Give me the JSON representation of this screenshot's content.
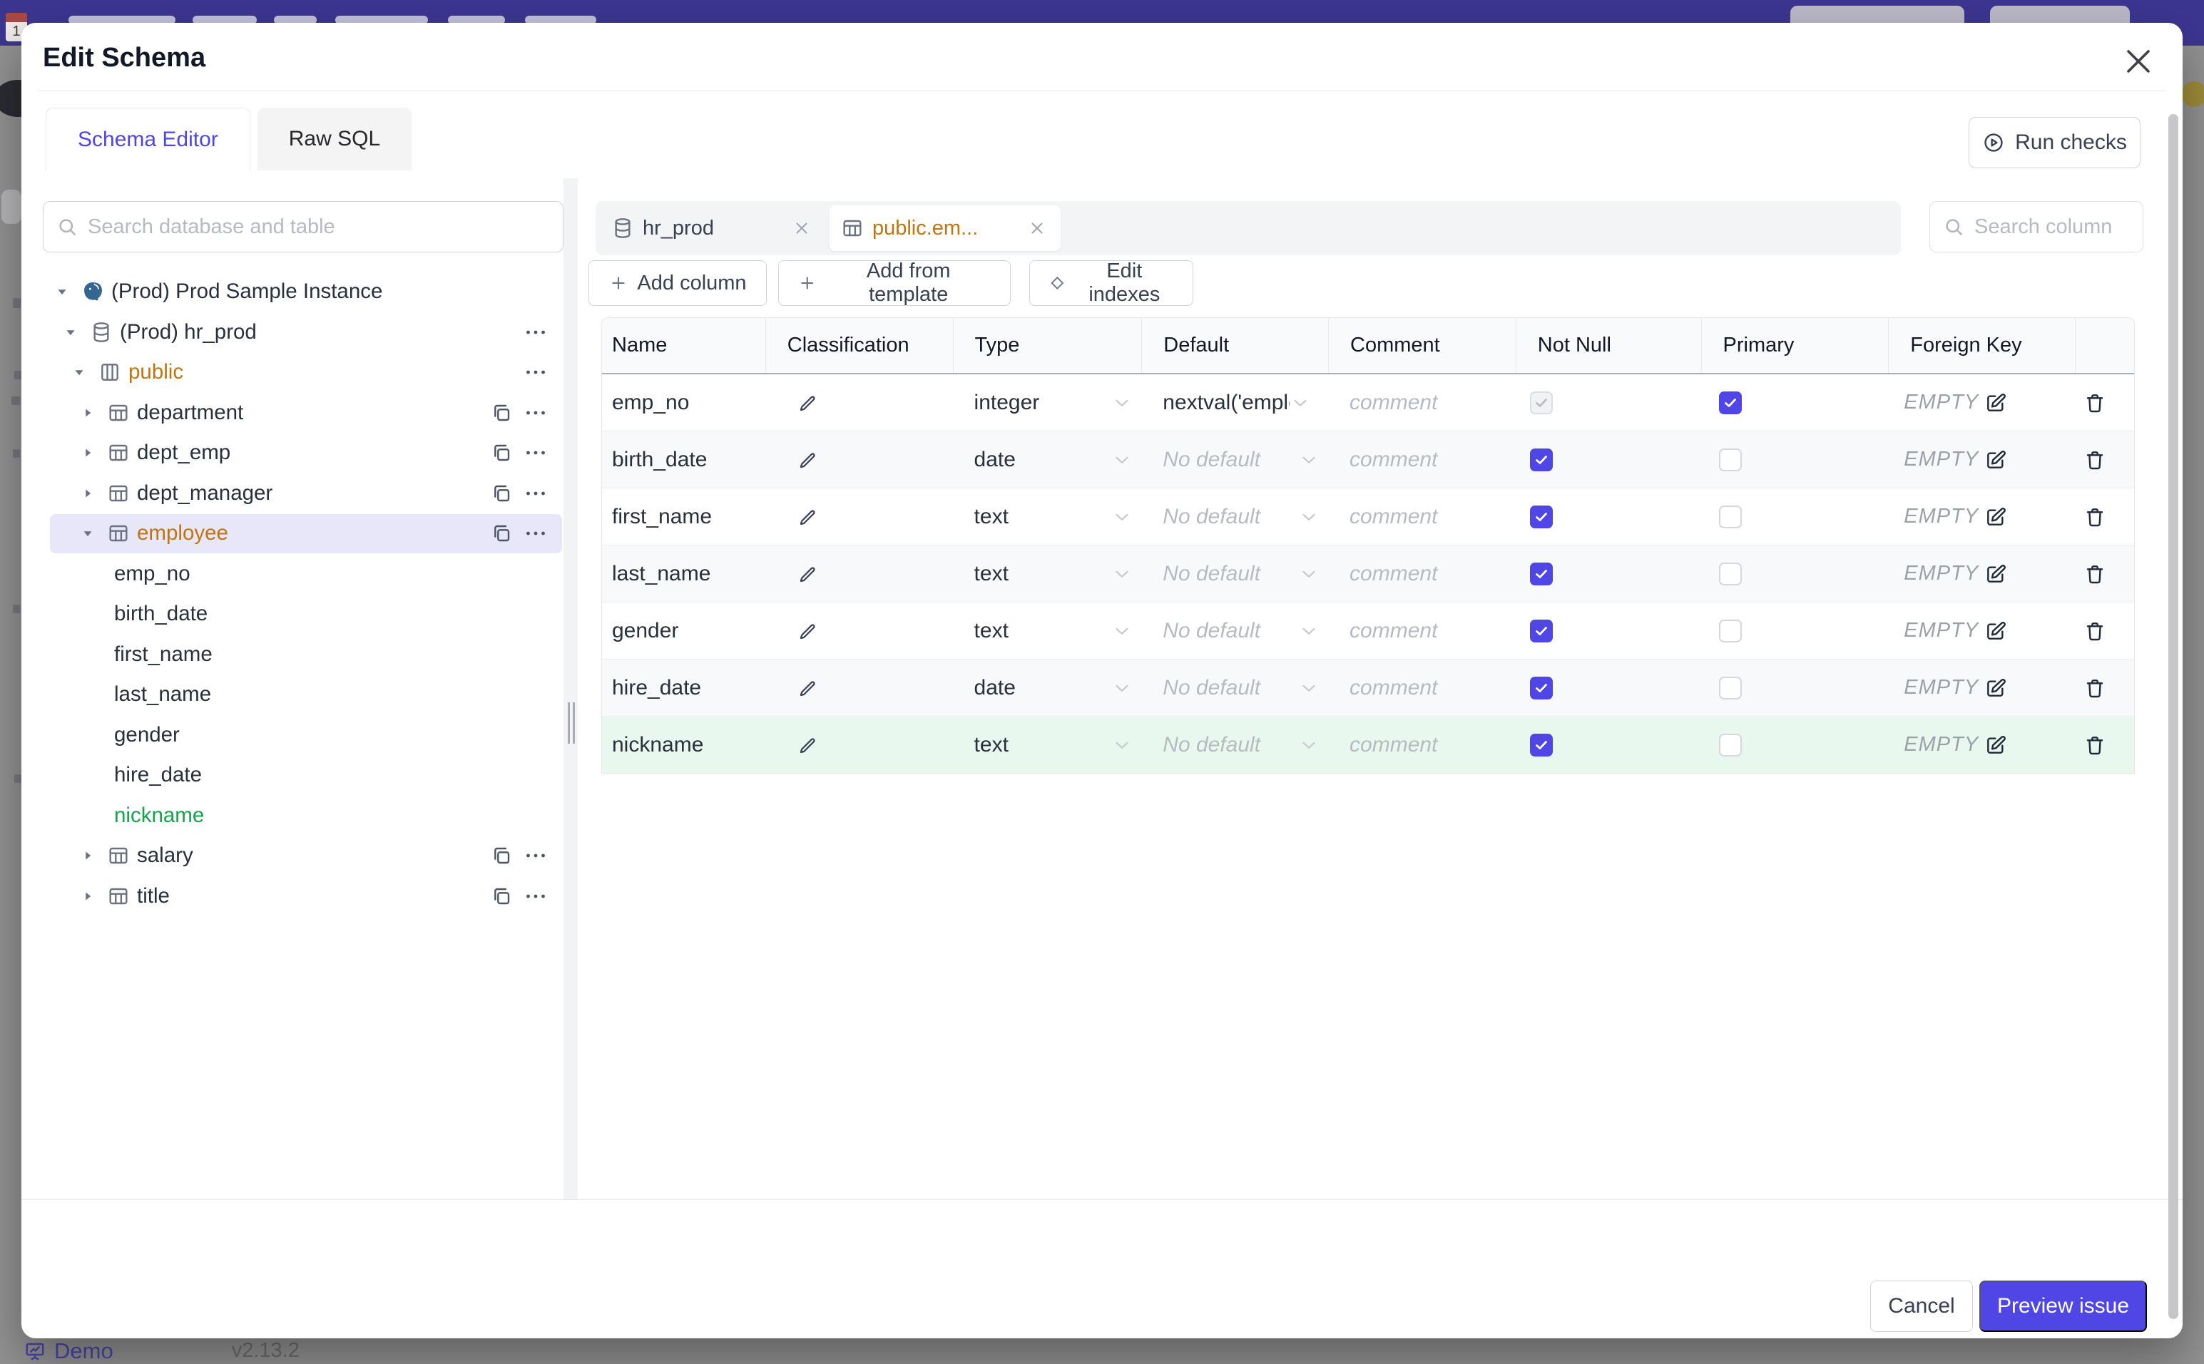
{
  "modal": {
    "title": "Edit Schema",
    "close_label": "✕",
    "tabs": [
      {
        "label": "Schema Editor",
        "active": true
      },
      {
        "label": "Raw SQL",
        "active": false
      }
    ],
    "run_checks_label": "Run checks",
    "footer": {
      "cancel_label": "Cancel",
      "primary_label": "Preview issue"
    }
  },
  "sidebar": {
    "search_placeholder": "Search database and table",
    "tree": [
      {
        "label": "(Prod) Prod Sample Instance",
        "level": 0,
        "icon": "postgres",
        "caret": "down",
        "color": null,
        "selected": false,
        "copy": false,
        "more": false
      },
      {
        "label": "(Prod) hr_prod",
        "level": 1,
        "icon": "database",
        "caret": "down",
        "color": null,
        "selected": false,
        "copy": false,
        "more": true
      },
      {
        "label": "public",
        "level": 2,
        "icon": "schema",
        "caret": "down",
        "color": "amber",
        "selected": false,
        "copy": false,
        "more": true
      },
      {
        "label": "department",
        "level": 3,
        "icon": "table",
        "caret": "right",
        "color": null,
        "selected": false,
        "copy": true,
        "more": true
      },
      {
        "label": "dept_emp",
        "level": 3,
        "icon": "table",
        "caret": "right",
        "color": null,
        "selected": false,
        "copy": true,
        "more": true
      },
      {
        "label": "dept_manager",
        "level": 3,
        "icon": "table",
        "caret": "right",
        "color": null,
        "selected": false,
        "copy": true,
        "more": true
      },
      {
        "label": "employee",
        "level": 3,
        "icon": "table",
        "caret": "down",
        "color": "amber",
        "selected": true,
        "copy": true,
        "more": true
      },
      {
        "label": "emp_no",
        "level": 4,
        "icon": null,
        "caret": null,
        "color": null,
        "selected": false,
        "copy": false,
        "more": false
      },
      {
        "label": "birth_date",
        "level": 4,
        "icon": null,
        "caret": null,
        "color": null,
        "selected": false,
        "copy": false,
        "more": false
      },
      {
        "label": "first_name",
        "level": 4,
        "icon": null,
        "caret": null,
        "color": null,
        "selected": false,
        "copy": false,
        "more": false
      },
      {
        "label": "last_name",
        "level": 4,
        "icon": null,
        "caret": null,
        "color": null,
        "selected": false,
        "copy": false,
        "more": false
      },
      {
        "label": "gender",
        "level": 4,
        "icon": null,
        "caret": null,
        "color": null,
        "selected": false,
        "copy": false,
        "more": false
      },
      {
        "label": "hire_date",
        "level": 4,
        "icon": null,
        "caret": null,
        "color": null,
        "selected": false,
        "copy": false,
        "more": false
      },
      {
        "label": "nickname",
        "level": 4,
        "icon": null,
        "caret": null,
        "color": "green",
        "selected": false,
        "copy": false,
        "more": false
      },
      {
        "label": "salary",
        "level": 3,
        "icon": "table",
        "caret": "right",
        "color": null,
        "selected": false,
        "copy": true,
        "more": true
      },
      {
        "label": "title",
        "level": 3,
        "icon": "table",
        "caret": "right",
        "color": null,
        "selected": false,
        "copy": true,
        "more": true
      }
    ]
  },
  "editor": {
    "tabs": [
      {
        "label": "hr_prod",
        "icon": "database",
        "active": false
      },
      {
        "label": "public.em...",
        "icon": "table",
        "active": true
      }
    ],
    "search_placeholder": "Search column",
    "toolbar": [
      {
        "icon": "plus",
        "label": "Add column"
      },
      {
        "icon": "plus",
        "label": "Add from template"
      },
      {
        "icon": "diamond",
        "label": "Edit indexes"
      }
    ],
    "table": {
      "headers": [
        "Name",
        "Classification",
        "Type",
        "Default",
        "Comment",
        "Not Null",
        "Primary",
        "Foreign Key",
        ""
      ],
      "comment_placeholder": "comment",
      "no_default_label": "No default",
      "foreign_key_empty_label": "EMPTY",
      "rows": [
        {
          "name": "emp_no",
          "type": "integer",
          "default": "nextval('employ",
          "default_muted": false,
          "not_null": true,
          "not_null_disabled": true,
          "primary": true,
          "state": "normal"
        },
        {
          "name": "birth_date",
          "type": "date",
          "default": "No default",
          "default_muted": true,
          "not_null": true,
          "not_null_disabled": false,
          "primary": false,
          "state": "normal"
        },
        {
          "name": "first_name",
          "type": "text",
          "default": "No default",
          "default_muted": true,
          "not_null": true,
          "not_null_disabled": false,
          "primary": false,
          "state": "normal"
        },
        {
          "name": "last_name",
          "type": "text",
          "default": "No default",
          "default_muted": true,
          "not_null": true,
          "not_null_disabled": false,
          "primary": false,
          "state": "normal"
        },
        {
          "name": "gender",
          "type": "text",
          "default": "No default",
          "default_muted": true,
          "not_null": true,
          "not_null_disabled": false,
          "primary": false,
          "state": "normal"
        },
        {
          "name": "hire_date",
          "type": "date",
          "default": "No default",
          "default_muted": true,
          "not_null": true,
          "not_null_disabled": false,
          "primary": false,
          "state": "normal"
        },
        {
          "name": "nickname",
          "type": "text",
          "default": "No default",
          "default_muted": true,
          "not_null": true,
          "not_null_disabled": false,
          "primary": false,
          "state": "new"
        }
      ]
    }
  },
  "background": {
    "demo_label": "Demo",
    "version": "v2.13.2",
    "calendar_day": "1"
  },
  "colors": {
    "accent": "#4f46e5",
    "selected_row_bg": "#e8e6f9",
    "amber": "#c2740f",
    "green": "#16a34a",
    "new_row_bg": "#e9f8ef",
    "topbar": "#3d3691",
    "backdrop": "#939393"
  }
}
